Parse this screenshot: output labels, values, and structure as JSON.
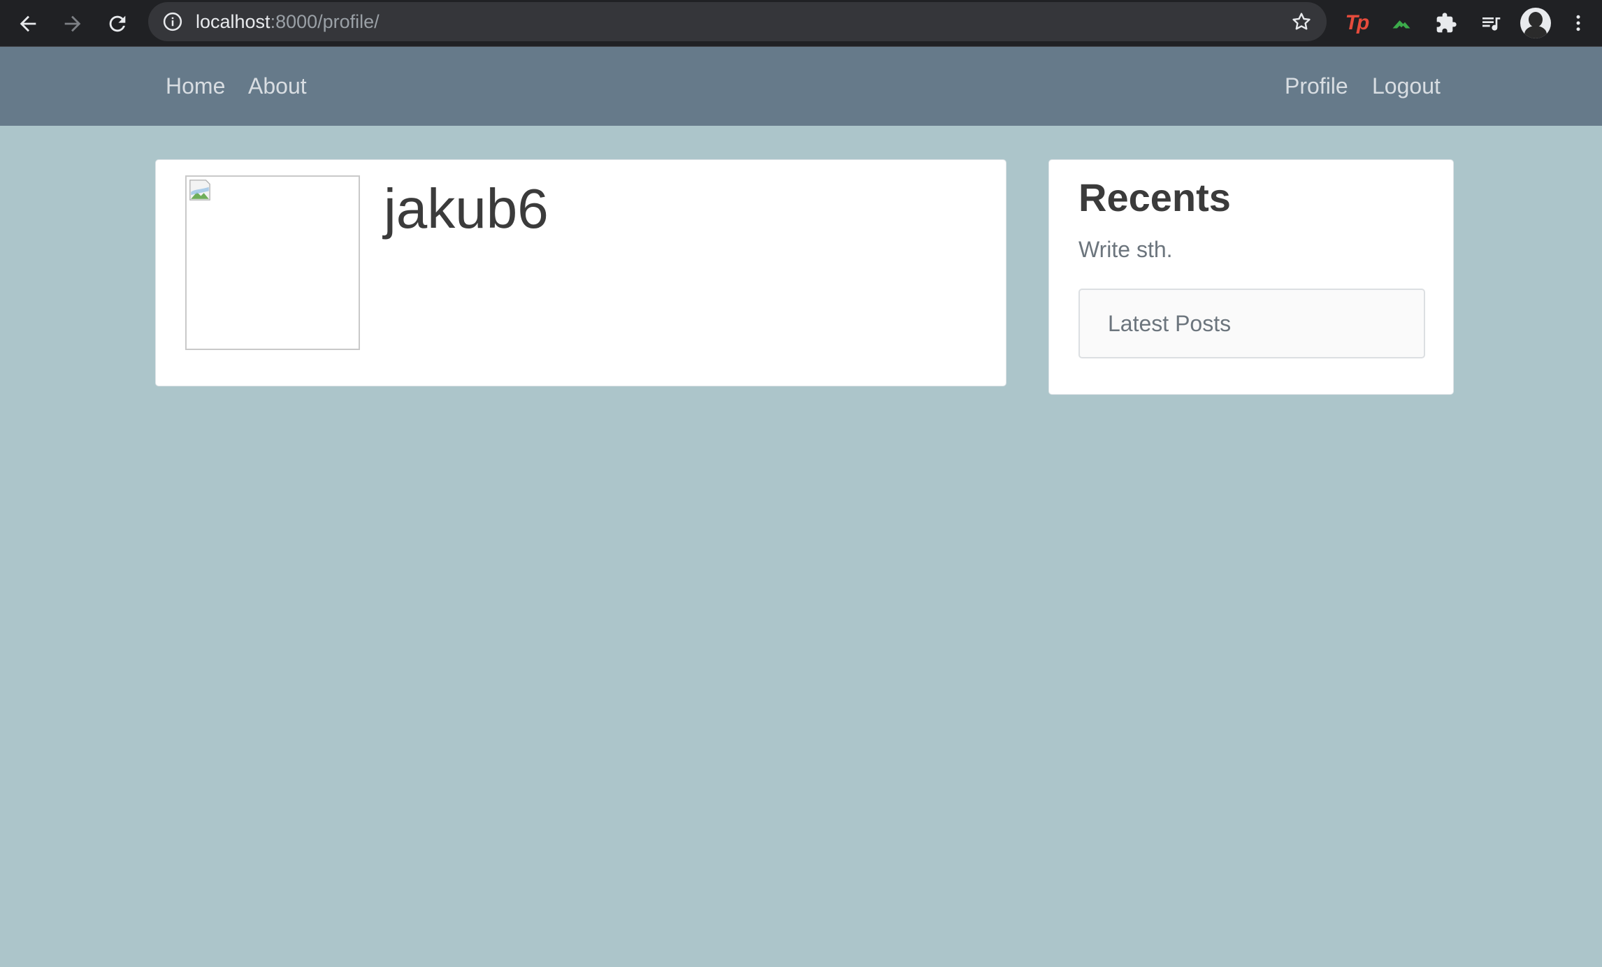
{
  "browser": {
    "url_host": "localhost",
    "url_rest": ":8000/profile/",
    "extension_tp_label": "Tp"
  },
  "navbar": {
    "left_links": [
      "Home",
      "About"
    ],
    "right_links": [
      "Profile",
      "Logout"
    ]
  },
  "profile": {
    "username": "jakub6"
  },
  "sidebar": {
    "title": "Recents",
    "subtitle": "Write sth.",
    "list_item": "Latest Posts"
  },
  "colors": {
    "page_background": "#acc5ca",
    "navbar_background": "#667a8a",
    "browser_chrome": "#202124"
  }
}
